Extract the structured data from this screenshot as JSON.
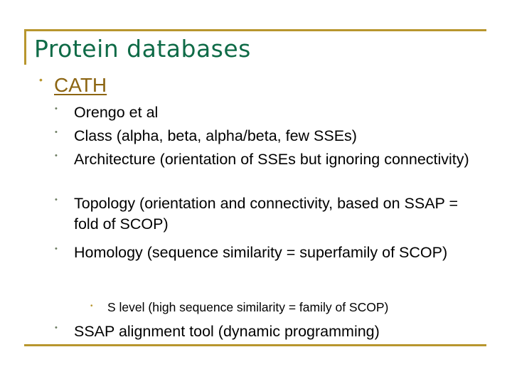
{
  "slide": {
    "title": "Protein databases",
    "level1": {
      "bullet": "•",
      "label": "CATH"
    },
    "items": [
      {
        "bullet": "•",
        "text": "Orengo et al"
      },
      {
        "bullet": "•",
        "text": "Class (alpha, beta, alpha/beta, few SSEs)"
      },
      {
        "bullet": "•",
        "text": "Architecture (orientation of SSEs but ignoring connectivity)"
      },
      {
        "bullet": "•",
        "text": "Topology (orientation and connectivity, based on SSAP = fold of SCOP)"
      },
      {
        "bullet": "•",
        "text": "Homology (sequence similarity = superfamily of SCOP)"
      }
    ],
    "sub_item": {
      "bullet": "•",
      "text": "S level (high sequence similarity = family of SCOP)"
    },
    "last_item": {
      "bullet": "•",
      "text": "SSAP alignment tool (dynamic programming)"
    }
  },
  "colors": {
    "accent_rule": "#b8962e",
    "title": "#0f6b47",
    "link": "#8c6512"
  }
}
